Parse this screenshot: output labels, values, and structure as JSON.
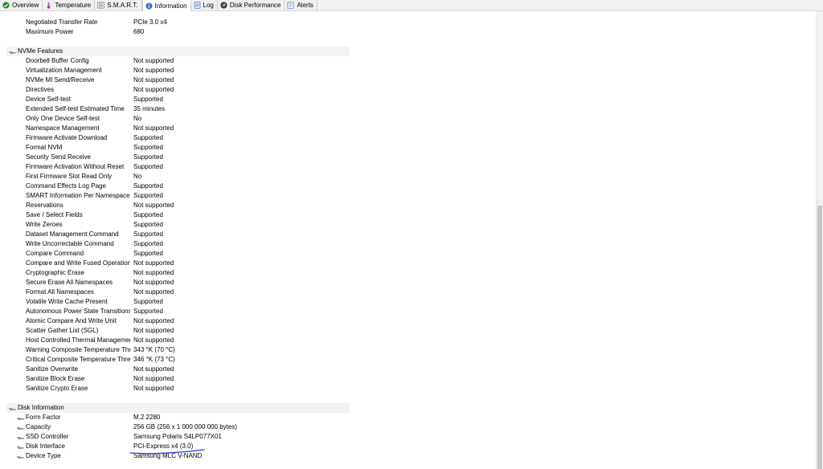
{
  "tabs": [
    {
      "label": "Overview",
      "icon": "check-circle-icon",
      "active": false
    },
    {
      "label": "Temperature",
      "icon": "thermometer-icon",
      "active": false
    },
    {
      "label": "S.M.A.R.T.",
      "icon": "smart-list-icon",
      "active": false
    },
    {
      "label": "Information",
      "icon": "info-icon",
      "active": true
    },
    {
      "label": "Log",
      "icon": "log-icon",
      "active": false
    },
    {
      "label": "Disk Performance",
      "icon": "gauge-icon",
      "active": false
    },
    {
      "label": "Alerts",
      "icon": "alerts-icon",
      "active": false
    }
  ],
  "top_rows": [
    {
      "key": "Negotiated Transfer Rate",
      "value": "PCIe 3.0 x4"
    },
    {
      "key": "Maximum Power",
      "value": "680"
    }
  ],
  "nvme_section": {
    "title": "NVMe Features",
    "rows": [
      {
        "key": "Doorbell Buffer Config",
        "value": "Not supported"
      },
      {
        "key": "Virtualization Management",
        "value": "Not supported"
      },
      {
        "key": "NVMe MI Send/Receive",
        "value": "Not supported"
      },
      {
        "key": "Directives",
        "value": "Not supported"
      },
      {
        "key": "Device Self-test",
        "value": "Supported"
      },
      {
        "key": "Extended Self-test Estimated Time",
        "value": "35 minutes"
      },
      {
        "key": "Only One Device Self-test",
        "value": "No"
      },
      {
        "key": "Namespace Management",
        "value": "Not supported"
      },
      {
        "key": "Firmware Activate Download",
        "value": "Supported"
      },
      {
        "key": "Format NVM",
        "value": "Supported"
      },
      {
        "key": "Security Send Receive",
        "value": "Supported"
      },
      {
        "key": "Firmware Activation Without Reset",
        "value": "Supported"
      },
      {
        "key": "First Firmware Slot Read Only",
        "value": "No"
      },
      {
        "key": "Command Effects Log Page",
        "value": "Supported"
      },
      {
        "key": "SMART Information Per Namespace",
        "value": "Supported"
      },
      {
        "key": "Reservations",
        "value": "Not supported"
      },
      {
        "key": "Save / Select Fields",
        "value": "Supported"
      },
      {
        "key": "Write Zeroes",
        "value": "Supported"
      },
      {
        "key": "Dataset Management Command",
        "value": "Supported"
      },
      {
        "key": "Write Uncorrectable Command",
        "value": "Supported"
      },
      {
        "key": "Compare Command",
        "value": "Supported"
      },
      {
        "key": "Compare and Write Fused Operation",
        "value": "Not supported"
      },
      {
        "key": "Cryptographic Erase",
        "value": "Not supported"
      },
      {
        "key": "Secure Erase All Namespaces",
        "value": "Not supported"
      },
      {
        "key": "Format All Namespaces",
        "value": "Not supported"
      },
      {
        "key": "Volatile Write Cache Present",
        "value": "Supported"
      },
      {
        "key": "Autonomous Power State Transitions",
        "value": "Supported"
      },
      {
        "key": "Atomic Compare And Write Unit",
        "value": "Not supported"
      },
      {
        "key": "Scatter Gather List (SGL)",
        "value": "Not supported"
      },
      {
        "key": "Host Controlled Thermal Management",
        "value": "Not supported"
      },
      {
        "key": "Warning Composite Temperature Thr...",
        "value": "343 °K (70 °C)"
      },
      {
        "key": "Critical Composite Temperature Thre...",
        "value": "346 °K (73 °C)"
      },
      {
        "key": "Sanitize Overwrite",
        "value": "Not supported"
      },
      {
        "key": "Sanitize Block Erase",
        "value": "Not supported"
      },
      {
        "key": "Sanitize Crypto Erase",
        "value": "Not supported"
      }
    ]
  },
  "disk_section": {
    "title": "Disk Information",
    "rows": [
      {
        "key": "Form Factor",
        "value": "M.2 2280"
      },
      {
        "key": "Capacity",
        "value": "256 GB (256 x 1 000 000 000 bytes)"
      },
      {
        "key": "SSD Controller",
        "value": "Samsung Polaris S4LP077X01"
      },
      {
        "key": "Disk Interface",
        "value": "PCI-Express x4 (3.0)"
      },
      {
        "key": "Device Type",
        "value": "Samsung MLC V-NAND"
      }
    ]
  },
  "colors": {
    "annotation_underline": "#1f3fd6",
    "section_background": "#f3f3f3",
    "tabbar_background": "#f0f0f0"
  }
}
